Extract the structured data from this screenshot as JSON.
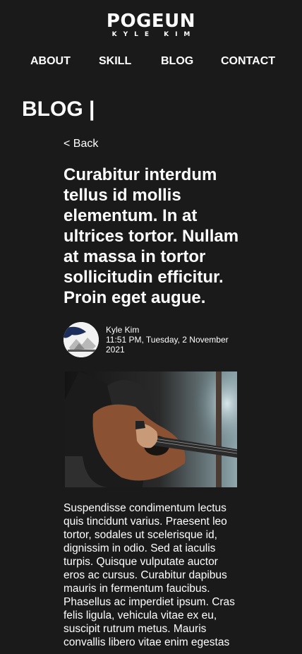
{
  "header": {
    "logo_title": "POGEUN",
    "logo_subtitle": "KYLE KIM"
  },
  "nav": {
    "items": [
      {
        "label": "ABOUT"
      },
      {
        "label": "SKILL"
      },
      {
        "label": "BLOG"
      },
      {
        "label": "CONTACT"
      }
    ]
  },
  "page": {
    "title": "BLOG |"
  },
  "post": {
    "back_label": "< Back",
    "title": "Curabitur interdum tellus id mollis elementum. In at ultrices tortor. Nullam at massa in tortor sollicitudin efficitur. Proin eget augue.",
    "author": "Kyle Kim",
    "date": "11:51 PM, Tuesday, 2 November 2021",
    "body": "Suspendisse condimentum lectus quis tincidunt varius. Praesent leo tortor, sodales ut scelerisque id, dignissim in odio. Sed at iaculis turpis. Quisque vulputate auctor eros ac cursus. Curabitur dapibus mauris in fermentum faucibus. Phasellus ac imperdiet ipsum. Cras felis ligula, vehicula vitae ex eu, suscipit rutrum metus. Mauris convallis libero vitae enim egestas"
  },
  "images": {
    "avatar_icon": "author-avatar-icon",
    "hero_subject": "guitar-photo"
  },
  "colors": {
    "background": "#1a1a1a",
    "text": "#ffffff"
  }
}
